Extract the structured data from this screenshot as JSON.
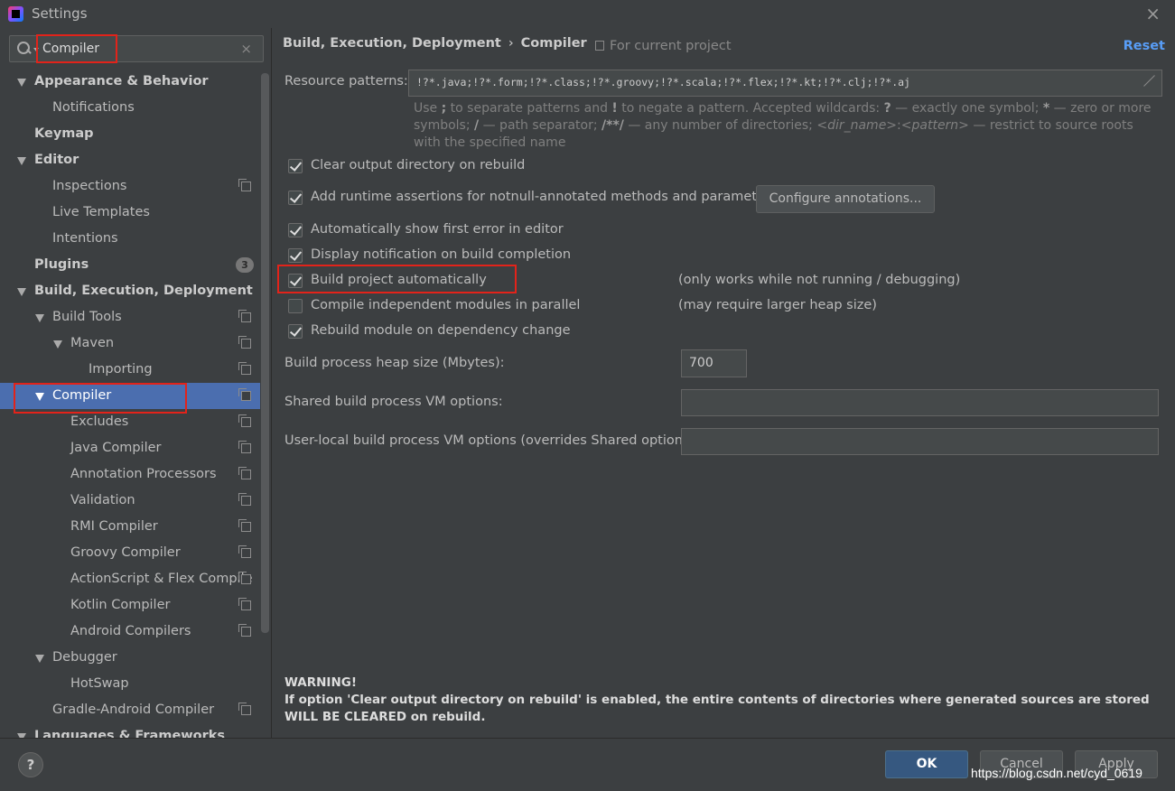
{
  "window": {
    "title": "Settings",
    "close_icon": "×"
  },
  "search": {
    "value": "Compiler",
    "clear": "×"
  },
  "tree": {
    "items": [
      {
        "label": "Appearance & Behavior",
        "level": 0,
        "arrow": true,
        "bold": true
      },
      {
        "label": "Notifications",
        "level": 1
      },
      {
        "label": "Keymap",
        "level": 0,
        "bold": true
      },
      {
        "label": "Editor",
        "level": 0,
        "arrow": true,
        "bold": true
      },
      {
        "label": "Inspections",
        "level": 1,
        "proj": true
      },
      {
        "label": "Live Templates",
        "level": 1
      },
      {
        "label": "Intentions",
        "level": 1
      },
      {
        "label": "Plugins",
        "level": 0,
        "bold": true,
        "badge": "3"
      },
      {
        "label": "Build, Execution, Deployment",
        "level": 0,
        "arrow": true,
        "bold": true
      },
      {
        "label": "Build Tools",
        "level": 1,
        "arrow": true,
        "proj": true
      },
      {
        "label": "Maven",
        "level": 2,
        "arrow": true,
        "proj": true
      },
      {
        "label": "Importing",
        "level": 3,
        "proj": true
      },
      {
        "label": "Compiler",
        "level": 1,
        "arrow": true,
        "proj": true,
        "selected": true
      },
      {
        "label": "Excludes",
        "level": 2,
        "proj": true
      },
      {
        "label": "Java Compiler",
        "level": 2,
        "proj": true
      },
      {
        "label": "Annotation Processors",
        "level": 2,
        "proj": true
      },
      {
        "label": "Validation",
        "level": 2,
        "proj": true
      },
      {
        "label": "RMI Compiler",
        "level": 2,
        "proj": true
      },
      {
        "label": "Groovy Compiler",
        "level": 2,
        "proj": true
      },
      {
        "label": "ActionScript & Flex Compile",
        "level": 2,
        "proj": true
      },
      {
        "label": "Kotlin Compiler",
        "level": 2,
        "proj": true
      },
      {
        "label": "Android Compilers",
        "level": 2,
        "proj": true
      },
      {
        "label": "Debugger",
        "level": 1,
        "arrow": true
      },
      {
        "label": "HotSwap",
        "level": 2
      },
      {
        "label": "Gradle-Android Compiler",
        "level": 1,
        "proj": true
      },
      {
        "label": "Languages & Frameworks",
        "level": 0,
        "arrow": true,
        "bold": true
      }
    ]
  },
  "header": {
    "crumb_parent": "Build, Execution, Deployment",
    "crumb_sep": "›",
    "crumb_current": "Compiler",
    "for_project": "For current project",
    "reset": "Reset"
  },
  "resource_patterns": {
    "label": "Resource patterns:",
    "value": "!?*.java;!?*.form;!?*.class;!?*.groovy;!?*.scala;!?*.flex;!?*.kt;!?*.clj;!?*.aj"
  },
  "hint": {
    "p1": "Use ",
    "b1": ";",
    "p2": " to separate patterns and ",
    "b2": "!",
    "p3": " to negate a pattern. Accepted wildcards: ",
    "b3": "?",
    "p4": " — exactly one symbol; ",
    "b4": "*",
    "p5": " — zero or more symbols; ",
    "b5": "/",
    "p6": " — path separator; ",
    "b6": "/**/",
    "p7": " — any number of directories; ",
    "i1": "<dir_name>",
    "p8": ":",
    "i2": "<pattern>",
    "p9": " — restrict to source roots with the specified name"
  },
  "options": {
    "clear_output": {
      "label": "Clear output directory on rebuild",
      "checked": true
    },
    "runtime_assertions": {
      "label": "Add runtime assertions for notnull-annotated methods and parameters",
      "checked": true
    },
    "configure_annotations": "Configure annotations...",
    "show_first_error": {
      "label": "Automatically show first error in editor",
      "checked": true
    },
    "notify_build": {
      "label": "Display notification on build completion",
      "checked": true
    },
    "build_auto": {
      "label": "Build project automatically",
      "checked": true,
      "note": "(only works while not running / debugging)"
    },
    "compile_parallel": {
      "label": "Compile independent modules in parallel",
      "checked": false,
      "note": "(may require larger heap size)"
    },
    "rebuild_dep": {
      "label": "Rebuild module on dependency change",
      "checked": true
    }
  },
  "fields": {
    "heap_label": "Build process heap size (Mbytes):",
    "heap_value": "700",
    "shared_vm_label": "Shared build process VM options:",
    "shared_vm_value": "",
    "user_vm_label": "User-local build process VM options (overrides Shared options):",
    "user_vm_value": ""
  },
  "warning": {
    "title": "WARNING!",
    "text": "If option 'Clear output directory on rebuild' is enabled, the entire contents of directories where generated sources are stored WILL BE CLEARED on rebuild."
  },
  "footer": {
    "help": "?",
    "ok": "OK",
    "cancel": "Cancel",
    "apply": "Apply",
    "watermark": "https://blog.csdn.net/cyd_0619"
  },
  "colors": {
    "accent": "#4b6eaf",
    "highlight_box": "#e2231a",
    "link": "#589df6",
    "ok_button": "#365880"
  }
}
